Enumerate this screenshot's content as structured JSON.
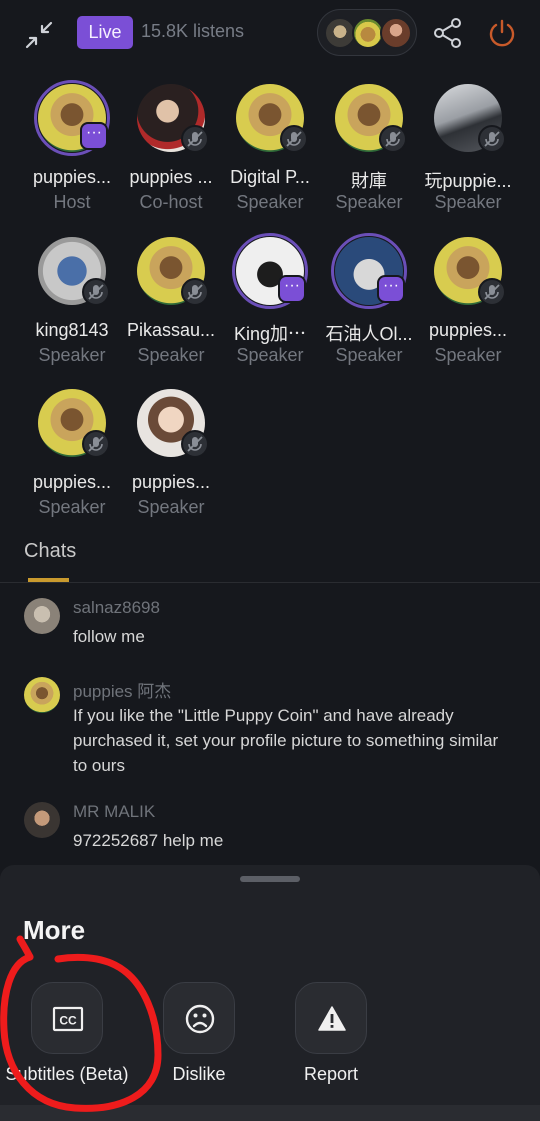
{
  "header": {
    "live_label": "Live",
    "listens": "15.8K listens",
    "icons": [
      "collapse-icon",
      "share-icon",
      "power-icon"
    ]
  },
  "participants": [
    {
      "name": "puppies...",
      "role": "Host",
      "badge": "more"
    },
    {
      "name": "puppies ...",
      "role": "Co-host",
      "badge": "mic"
    },
    {
      "name": "Digital P...",
      "role": "Speaker",
      "badge": "mic"
    },
    {
      "name": "財庫",
      "role": "Speaker",
      "badge": "mic"
    },
    {
      "name": "玩puppie...",
      "role": "Speaker",
      "badge": "mic"
    },
    {
      "name": "king8143",
      "role": "Speaker",
      "badge": "mic"
    },
    {
      "name": "Pikassau...",
      "role": "Speaker",
      "badge": "mic"
    },
    {
      "name": "King加⋯",
      "role": "Speaker",
      "badge": "more"
    },
    {
      "name": "石油人Ol...",
      "role": "Speaker",
      "badge": "more"
    },
    {
      "name": "puppies...",
      "role": "Speaker",
      "badge": "mic"
    },
    {
      "name": "puppies...",
      "role": "Speaker",
      "badge": "mic"
    },
    {
      "name": "puppies...",
      "role": "Speaker",
      "badge": "mic"
    }
  ],
  "chats": {
    "tab_label": "Chats",
    "messages": [
      {
        "user": "salnaz8698",
        "text": "follow me"
      },
      {
        "user": "puppies 阿杰",
        "text": "If you like the \"Little Puppy Coin\" and have already purchased it, set your profile picture to something similar to ours"
      },
      {
        "user": "MR  MALIK",
        "text": "972252687 help me"
      }
    ]
  },
  "sheet": {
    "title": "More",
    "actions": [
      {
        "label": "Subtitles (Beta)",
        "icon": "cc-icon"
      },
      {
        "label": "Dislike",
        "icon": "frown-icon"
      },
      {
        "label": "Report",
        "icon": "warning-icon"
      }
    ]
  },
  "colors": {
    "background": "#16181d",
    "live_badge": "#7b4fd6",
    "chats_underline": "#c99a2e",
    "annotation": "#ee1c1c"
  }
}
